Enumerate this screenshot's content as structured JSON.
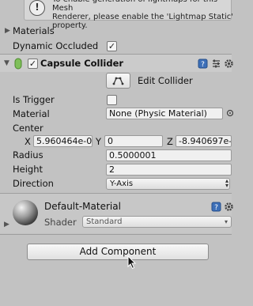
{
  "info_box": {
    "text": "To enable generation of lightmaps for this Mesh\nRenderer, please enable the 'Lightmap Static'\nproperty.",
    "icon": "info-icon"
  },
  "materials_row": {
    "label": "Materials"
  },
  "dynamic_occluded": {
    "label": "Dynamic Occluded",
    "checked": "✓"
  },
  "capsule_collider": {
    "title": "Capsule Collider",
    "enabled_check": "✓",
    "edit_collider_label": "Edit Collider",
    "is_trigger": {
      "label": "Is Trigger",
      "checked": ""
    },
    "material": {
      "label": "Material",
      "value": "None (Physic Material)"
    },
    "center": {
      "label": "Center",
      "x_label": "X",
      "x_value": "5.960464e-0",
      "y_label": "Y",
      "y_value": "0",
      "z_label": "Z",
      "z_value": "-8.940697e-"
    },
    "radius": {
      "label": "Radius",
      "value": "0.5000001"
    },
    "height": {
      "label": "Height",
      "value": "2"
    },
    "direction": {
      "label": "Direction",
      "value": "Y-Axis"
    }
  },
  "material_section": {
    "name": "Default-Material",
    "shader_label": "Shader",
    "shader_value": "Standard"
  },
  "add_component_label": "Add Component"
}
